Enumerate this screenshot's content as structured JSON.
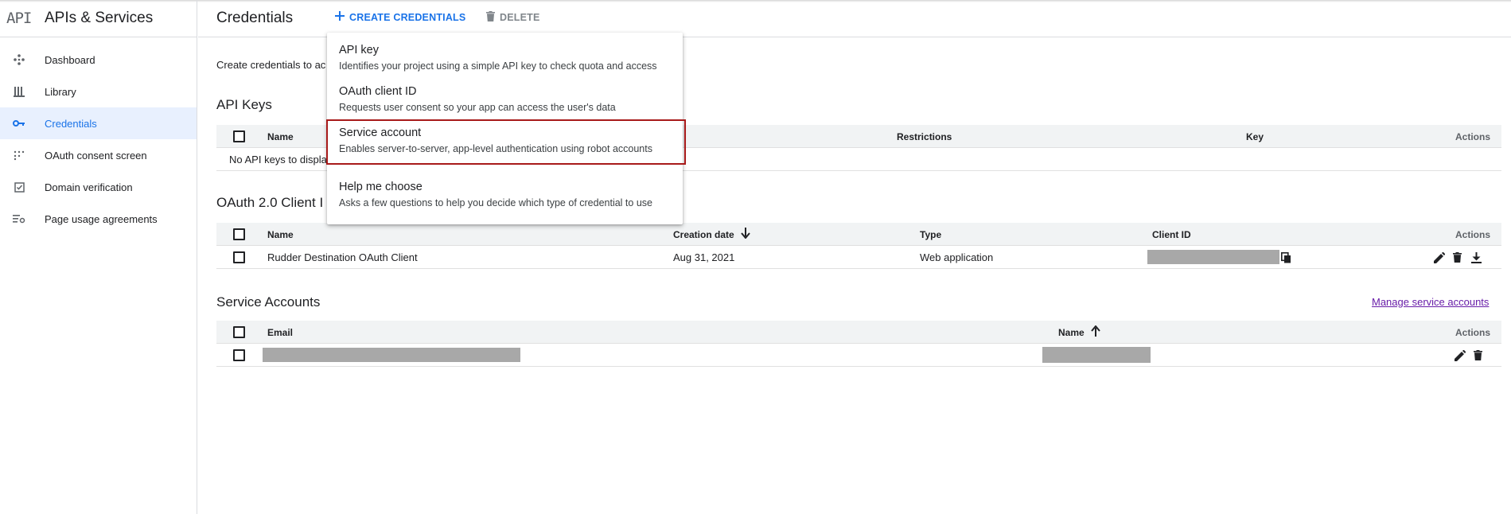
{
  "sidebar": {
    "logo": "API",
    "title": "APIs & Services",
    "items": [
      {
        "label": "Dashboard",
        "icon": "dashboard-icon",
        "active": false
      },
      {
        "label": "Library",
        "icon": "library-icon",
        "active": false
      },
      {
        "label": "Credentials",
        "icon": "key-icon",
        "active": true
      },
      {
        "label": "OAuth consent screen",
        "icon": "consent-icon",
        "active": false
      },
      {
        "label": "Domain verification",
        "icon": "checkbox-icon",
        "active": false
      },
      {
        "label": "Page usage agreements",
        "icon": "settings-list-icon",
        "active": false
      }
    ]
  },
  "header": {
    "title": "Credentials",
    "create_label": "CREATE CREDENTIALS",
    "delete_label": "DELETE"
  },
  "intro": "Create credentials to ac",
  "api_keys": {
    "title": "API Keys",
    "columns": [
      "Name",
      "Restrictions",
      "Key",
      "Actions"
    ],
    "empty_text": "No API keys to displa"
  },
  "oauth": {
    "title": "OAuth 2.0 Client I",
    "columns": [
      "Name",
      "Creation date",
      "Type",
      "Client ID",
      "Actions"
    ],
    "rows": [
      {
        "name": "Rudder Destination OAuth Client",
        "created": "Aug 31, 2021",
        "type": "Web application"
      }
    ]
  },
  "service_accounts": {
    "title": "Service Accounts",
    "manage_link": "Manage service accounts",
    "columns": [
      "Email",
      "Name",
      "Actions"
    ]
  },
  "menu": {
    "items": [
      {
        "title": "API key",
        "desc": "Identifies your project using a simple API key to check quota and access"
      },
      {
        "title": "OAuth client ID",
        "desc": "Requests user consent so your app can access the user's data"
      },
      {
        "title": "Service account",
        "desc": "Enables server-to-server, app-level authentication using robot accounts"
      },
      {
        "title": "Help me choose",
        "desc": "Asks a few questions to help you decide which type of credential to use"
      }
    ]
  },
  "colors": {
    "accent": "#1a73e8",
    "highlight": "#a81a1a",
    "link": "#681da8"
  }
}
